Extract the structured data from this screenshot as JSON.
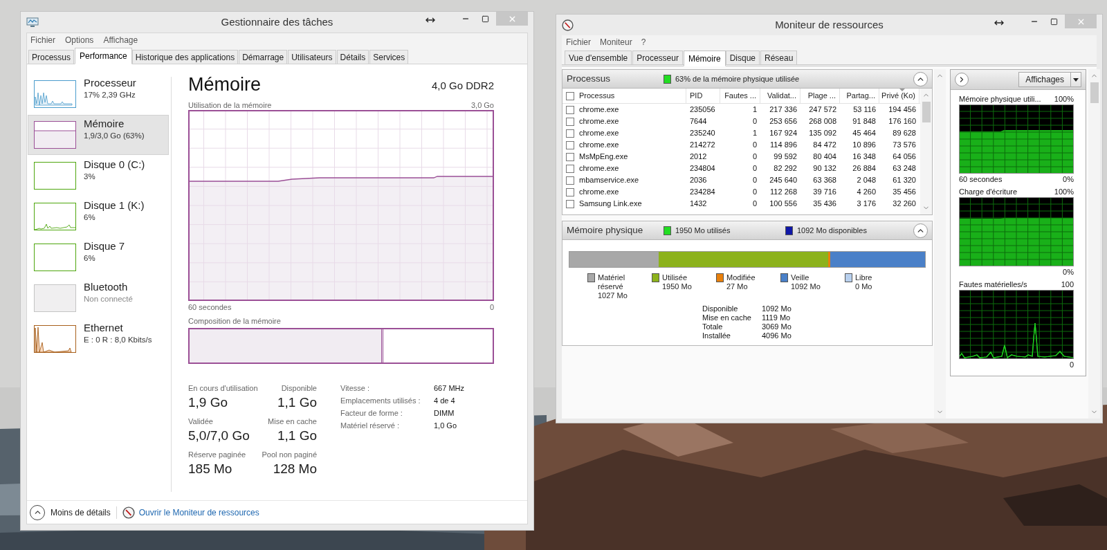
{
  "task_manager": {
    "title": "Gestionnaire des tâches",
    "menu": [
      "Fichier",
      "Options",
      "Affichage"
    ],
    "tabs": [
      {
        "label": "Processus",
        "selected": false
      },
      {
        "label": "Performance",
        "selected": true
      },
      {
        "label": "Historique des applications",
        "selected": false
      },
      {
        "label": "Démarrage",
        "selected": false
      },
      {
        "label": "Utilisateurs",
        "selected": false
      },
      {
        "label": "Détails",
        "selected": false
      },
      {
        "label": "Services",
        "selected": false
      }
    ],
    "sidebar": [
      {
        "kind": "cpu",
        "name": "Processeur",
        "detail": "17% 2,39 GHz",
        "color": "#4a9ccc",
        "selected": false
      },
      {
        "kind": "memory",
        "name": "Mémoire",
        "detail": "1,9/3,0 Go (63%)",
        "color": "#9b4f96",
        "selected": true
      },
      {
        "kind": "disk",
        "name": "Disque 0 (C:)",
        "detail": "3%",
        "color": "#4da60c",
        "selected": false
      },
      {
        "kind": "diskactive",
        "name": "Disque 1 (K:)",
        "detail": "6%",
        "color": "#4da60c",
        "selected": false
      },
      {
        "kind": "disk",
        "name": "Disque 7",
        "detail": "6%",
        "color": "#4da60c",
        "selected": false
      },
      {
        "kind": "bluetooth",
        "name": "Bluetooth",
        "detail": "Non connecté",
        "color": "#c4c4c4",
        "selected": false
      },
      {
        "kind": "network",
        "name": "Ethernet",
        "detail": "E : 0 R : 8,0 Kbits/s",
        "color": "#a75f1b",
        "selected": false
      }
    ],
    "heading": "Mémoire",
    "capacity": "4,0 Go DDR2",
    "usage_graph": {
      "label": "Utilisation de la mémoire",
      "max": "3,0 Go",
      "span": "60 secondes",
      "zero": "0"
    },
    "composition": {
      "label": "Composition de la mémoire",
      "level": 0.64
    },
    "stats": [
      {
        "label": "En cours d'utilisation",
        "value": "1,9 Go"
      },
      {
        "label": "Disponible",
        "value": "1,1 Go"
      },
      {
        "label": "Validée",
        "value": "5,0/7,0 Go"
      },
      {
        "label": "Mise en cache",
        "value": "1,1 Go"
      },
      {
        "label": "Réserve paginée",
        "value": "185 Mo"
      },
      {
        "label": "Pool non paginé",
        "value": "128 Mo"
      }
    ],
    "specs": [
      {
        "label": "Vitesse :",
        "value": "667 MHz"
      },
      {
        "label": "Emplacements utilisés :",
        "value": "4 de 4"
      },
      {
        "label": "Facteur de forme :",
        "value": "DIMM"
      },
      {
        "label": "Matériel réservé :",
        "value": "1,0 Go"
      }
    ],
    "footer": {
      "toggle": "Moins de détails",
      "link": "Ouvrir le Moniteur de ressources"
    }
  },
  "resource_monitor": {
    "title": "Moniteur de ressources",
    "menu": [
      "Fichier",
      "Moniteur",
      "?"
    ],
    "tabs": [
      {
        "label": "Vue d'ensemble",
        "selected": false
      },
      {
        "label": "Processeur",
        "selected": false
      },
      {
        "label": "Mémoire",
        "selected": true
      },
      {
        "label": "Disque",
        "selected": false
      },
      {
        "label": "Réseau",
        "selected": false
      }
    ],
    "processes": {
      "title": "Processus",
      "summary": "63% de la mémoire physique utilisée",
      "expanded": true,
      "all_checked": false,
      "columns": [
        {
          "label": "Processus",
          "sorted": false
        },
        {
          "label": "PID",
          "sorted": false
        },
        {
          "label": "Fautes ...",
          "sorted": false
        },
        {
          "label": "Validat...",
          "sorted": false
        },
        {
          "label": "Plage ...",
          "sorted": false
        },
        {
          "label": "Partag...",
          "sorted": false
        },
        {
          "label": "Privé (Ko)",
          "sorted": true
        }
      ],
      "rows": [
        {
          "checked": false,
          "cells": [
            "chrome.exe",
            "235056",
            "1",
            "217 336",
            "247 572",
            "53 116",
            "194 456"
          ]
        },
        {
          "checked": false,
          "cells": [
            "chrome.exe",
            "7644",
            "0",
            "253 656",
            "268 008",
            "91 848",
            "176 160"
          ]
        },
        {
          "checked": false,
          "cells": [
            "chrome.exe",
            "235240",
            "1",
            "167 924",
            "135 092",
            "45 464",
            "89 628"
          ]
        },
        {
          "checked": false,
          "cells": [
            "chrome.exe",
            "214272",
            "0",
            "114 896",
            "84 472",
            "10 896",
            "73 576"
          ]
        },
        {
          "checked": false,
          "cells": [
            "MsMpEng.exe",
            "2012",
            "0",
            "99 592",
            "80 404",
            "16 348",
            "64 056"
          ]
        },
        {
          "checked": false,
          "cells": [
            "chrome.exe",
            "234804",
            "0",
            "82 292",
            "90 132",
            "26 884",
            "63 248"
          ]
        },
        {
          "checked": false,
          "cells": [
            "mbamservice.exe",
            "2036",
            "0",
            "245 640",
            "63 368",
            "2 048",
            "61 320"
          ]
        },
        {
          "checked": false,
          "cells": [
            "chrome.exe",
            "234284",
            "0",
            "112 268",
            "39 716",
            "4 260",
            "35 456"
          ]
        },
        {
          "checked": false,
          "cells": [
            "Samsung Link.exe",
            "1432",
            "0",
            "100 556",
            "35 436",
            "3 176",
            "32 260"
          ]
        }
      ]
    },
    "physical": {
      "title": "Mémoire physique",
      "expanded": true,
      "counters": [
        {
          "text": "1950 Mo utilisés",
          "color": "#22dd22"
        },
        {
          "text": "1092 Mo disponibles",
          "color": "#1018a8"
        }
      ],
      "bar": [
        {
          "color": "#a8a8a8",
          "level": 0.251
        },
        {
          "color": "#8cb21c",
          "level": 0.476
        },
        {
          "color": "#e8800c",
          "level": 0.007
        },
        {
          "color": "#4a80c8",
          "level": 0.266
        }
      ],
      "segments": [
        {
          "label": "Matériel réservé",
          "value": "1027 Mo",
          "color": "#a8a8a8"
        },
        {
          "label": "Utilisée",
          "value": "1950 Mo",
          "color": "#8cb21c"
        },
        {
          "label": "Modifiée",
          "value": "27 Mo",
          "color": "#e8800c"
        },
        {
          "label": "Veille",
          "value": "1092 Mo",
          "color": "#4a80c8"
        },
        {
          "label": "Libre",
          "value": "0 Mo",
          "color": "#b8d0ee"
        }
      ],
      "summary": [
        {
          "label": "Disponible",
          "value": "1092 Mo"
        },
        {
          "label": "Mise en cache",
          "value": "1119 Mo"
        },
        {
          "label": "Totale",
          "value": "3069 Mo"
        },
        {
          "label": "Installée",
          "value": "4096 Mo"
        }
      ]
    },
    "panel": {
      "button": "Affichages",
      "graphs": [
        {
          "kind": "memory",
          "title": "Mémoire physique utili...",
          "max": "100%",
          "span": "60 secondes",
          "min": "0%"
        },
        {
          "kind": "commit",
          "title": "Charge d'écriture",
          "max": "100%",
          "min": "0%"
        },
        {
          "kind": "faults",
          "title": "Fautes matérielles/s",
          "max": "100",
          "min": "0"
        }
      ]
    }
  }
}
